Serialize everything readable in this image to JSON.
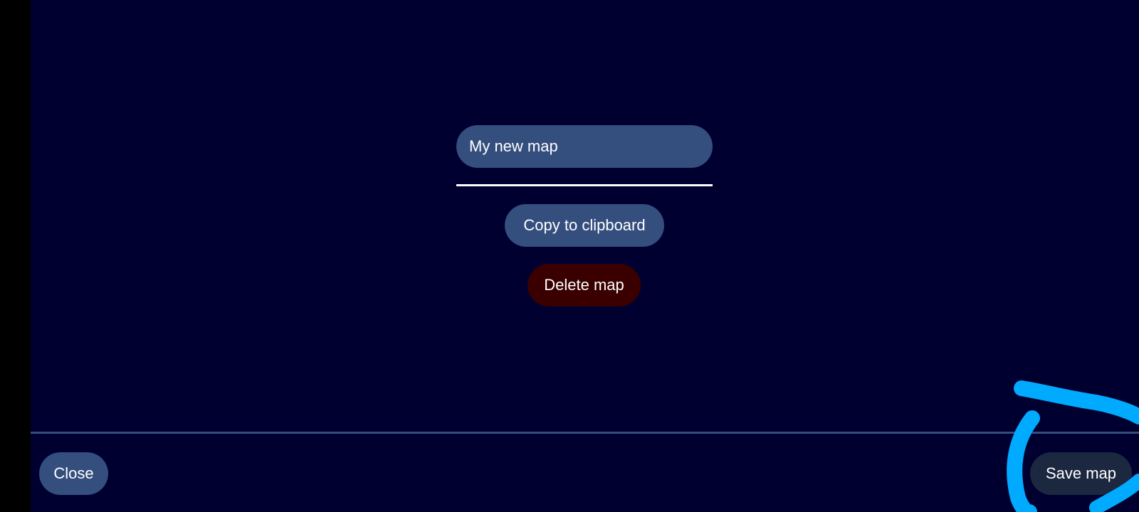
{
  "map_editor": {
    "name_value": "My new map",
    "copy_label": "Copy to clipboard",
    "delete_label": "Delete map"
  },
  "footer": {
    "close_label": "Close",
    "save_label": "Save map"
  },
  "colors": {
    "background": "#000030",
    "button": "#344e7e",
    "delete_button": "#3a0000",
    "save_button": "#1c2740",
    "annotation_stroke": "#00aaff"
  }
}
